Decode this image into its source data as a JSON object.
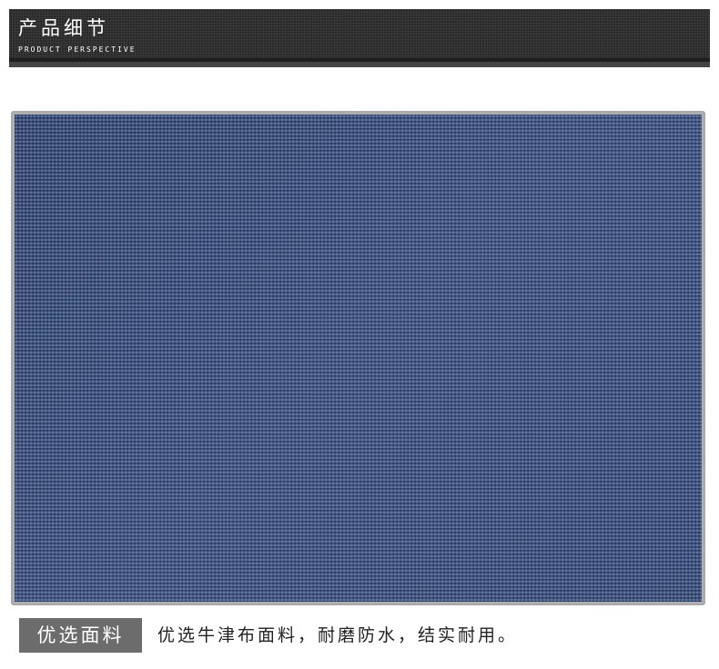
{
  "header": {
    "title": "产品细节",
    "subtitle": "PRODUCT PERSPECTIVE"
  },
  "colors": {
    "header_bg": "#2a2a2a",
    "fabric": "#3a4e78",
    "tag_bg": "#6c6c6c",
    "text": "#222222"
  },
  "feature": {
    "tag": "优选面料",
    "description": "优选牛津布面料，耐磨防水，结实耐用。"
  }
}
